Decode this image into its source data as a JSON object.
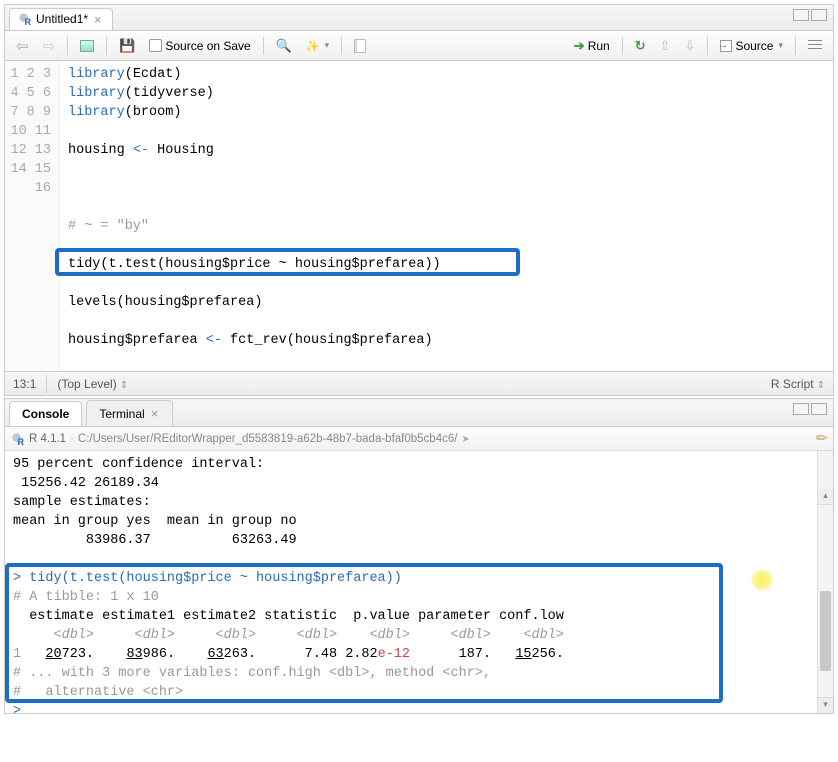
{
  "editor_pane": {
    "tab": {
      "title": "Untitled1*",
      "dirty": true
    },
    "toolbar": {
      "source_on_save": "Source on Save",
      "run": "Run",
      "source": "Source"
    },
    "lines": [
      "library(Ecdat)",
      "library(tidyverse)",
      "library(broom)",
      "",
      "housing <- Housing",
      "",
      "",
      "",
      "# ~ = \"by\"",
      "",
      "tidy(t.test(housing$price ~ housing$prefarea))",
      "",
      "levels(housing$prefarea)",
      "",
      "housing$prefarea <- fct_rev(housing$prefarea)",
      ""
    ],
    "status": {
      "pos": "13:1",
      "scope": "(Top Level)",
      "lang": "R Script"
    }
  },
  "console_pane": {
    "tabs": {
      "console": "Console",
      "terminal": "Terminal"
    },
    "info": {
      "version": "R 4.1.1",
      "path": "C:/Users/User/REditorWrapper_d5583819-a62b-48b7-bada-bfaf0b5cb4c6/"
    },
    "output": {
      "ci_header": "95 percent confidence interval:",
      "ci_values": " 15256.42 26189.34",
      "est_header": "sample estimates:",
      "est_groups": "mean in group yes  mean in group no ",
      "est_values": "         83986.37          63263.49 ",
      "blank": "",
      "cmd": "tidy(t.test(housing$price ~ housing$prefarea))",
      "tibble_header": "# A tibble: 1 x 10",
      "col_names": "  estimate estimate1 estimate2 statistic  p.value parameter conf.low",
      "col_types": "     <dbl>     <dbl>     <dbl>     <dbl>    <dbl>     <dbl>    <dbl>",
      "row1_pre": "1   ",
      "row1_est": "20",
      "row1_est_rest": "723.",
      "row1_e1": "83",
      "row1_e1_rest": "986.",
      "row1_e2": "63",
      "row1_e2_rest": "263.",
      "row1_stat": "7.48",
      "row1_pval_a": "2.82",
      "row1_pval_b": "e-12",
      "row1_param": "187.",
      "row1_cl": "15",
      "row1_cl_rest": "256.",
      "more1": "# ... with 3 more variables: conf.high <dbl>, method <chr>,",
      "more2": "#   alternative <chr>",
      "prompt": ">"
    }
  }
}
